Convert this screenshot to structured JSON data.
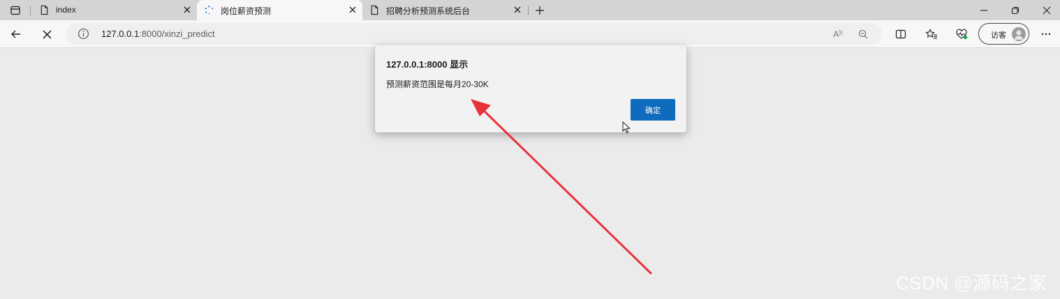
{
  "tabs": [
    {
      "label": "index",
      "icon": "page-icon",
      "active": false
    },
    {
      "label": "岗位薪资预测",
      "icon": "loading-icon",
      "active": true
    },
    {
      "label": "招聘分析预测系统后台",
      "icon": "page-icon",
      "active": false
    }
  ],
  "address": {
    "host": "127.0.0.1",
    "path": ":8000/xinzi_predict"
  },
  "profile": {
    "label": "访客"
  },
  "dialog": {
    "title": "127.0.0.1:8000 显示",
    "message": "预测薪资范围是每月20-30K",
    "ok_label": "确定"
  },
  "addr_read_label": "A",
  "watermark": "CSDN @源码之家",
  "colors": {
    "accent": "#0f6cbd",
    "annotation_arrow": "#e8323a"
  }
}
